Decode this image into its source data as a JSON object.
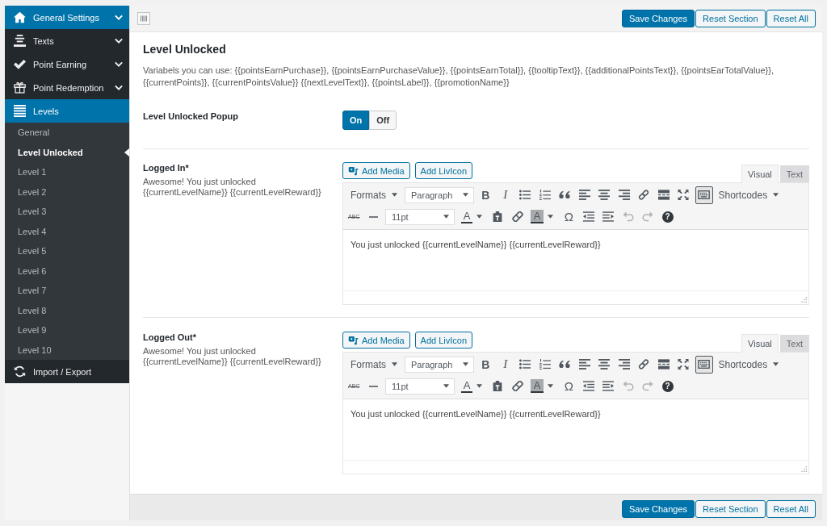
{
  "sidebar": {
    "items": [
      {
        "label": "General Settings",
        "selected": true,
        "expanded": false
      },
      {
        "label": "Texts",
        "selected": false,
        "expanded": false
      },
      {
        "label": "Point Earning",
        "selected": false,
        "expanded": false
      },
      {
        "label": "Point Redemption",
        "selected": false,
        "expanded": false
      },
      {
        "label": "Levels",
        "selected": true,
        "expanded": true,
        "children": [
          {
            "label": "General",
            "selected": false
          },
          {
            "label": "Level Unlocked",
            "selected": true
          },
          {
            "label": "Level 1",
            "selected": false
          },
          {
            "label": "Level 2",
            "selected": false
          },
          {
            "label": "Level 3",
            "selected": false
          },
          {
            "label": "Level 4",
            "selected": false
          },
          {
            "label": "Level 5",
            "selected": false
          },
          {
            "label": "Level 6",
            "selected": false
          },
          {
            "label": "Level 7",
            "selected": false
          },
          {
            "label": "Level 8",
            "selected": false
          },
          {
            "label": "Level 9",
            "selected": false
          },
          {
            "label": "Level 10",
            "selected": false
          }
        ]
      },
      {
        "label": "Import / Export",
        "selected": false
      }
    ]
  },
  "top_bar": {
    "buttons": [
      {
        "label": "Save Changes",
        "kind": "primary"
      },
      {
        "label": "Reset Section",
        "kind": "secondary"
      },
      {
        "label": "Reset All",
        "kind": "secondary"
      }
    ]
  },
  "section": {
    "title": "Level Unlocked",
    "description": "Variabels you can use: {{pointsEarnPurchase}}, {{pointsEarnPurchaseValue}}, {{pointsEarnTotal}}, {{tooltipText}}, {{additionalPointsText}}, {{pointsEarTotalValue}}, {{currentPoints}}, {{currentPointsValue}} {{nextLevelText}}, {{pointsLabel}}, {{promotionName}}"
  },
  "popup_setting": {
    "label": "Level Unlocked Popup",
    "options": [
      {
        "label": "On",
        "selected": true
      },
      {
        "label": "Off",
        "selected": false
      }
    ]
  },
  "editors": [
    {
      "label": "Logged In*",
      "description": "Awesome! You just unlocked {{currentLevelName}} {{currentLevelReward}}",
      "media_buttons": [
        "Add Media",
        "Add LivIcon"
      ],
      "tabs": [
        {
          "label": "Visual",
          "selected": true
        },
        {
          "label": "Text",
          "selected": false
        }
      ],
      "toolbar": {
        "formats_menu": "Formats",
        "block_format": "Paragraph",
        "bold": "B",
        "italic": "I",
        "shortcodes_menu": "Shortcodes",
        "strikethrough": "ABC",
        "font_size": "11pt",
        "text_color": "A",
        "background_color": "A",
        "special_character": "Ω",
        "help": "?",
        "toolbar_toggle_on": true,
        "undo_disabled": true,
        "redo_disabled": true
      },
      "content": "You just unlocked {{currentLevelName}} {{currentLevelReward}}"
    },
    {
      "label": "Logged Out*",
      "description": "Awesome! You just unlocked {{currentLevelName}} {{currentLevelReward}}",
      "media_buttons": [
        "Add Media",
        "Add LivIcon"
      ],
      "tabs": [
        {
          "label": "Visual",
          "selected": true
        },
        {
          "label": "Text",
          "selected": false
        }
      ],
      "toolbar": {
        "formats_menu": "Formats",
        "block_format": "Paragraph",
        "bold": "B",
        "italic": "I",
        "shortcodes_menu": "Shortcodes",
        "strikethrough": "ABC",
        "font_size": "11pt",
        "text_color": "A",
        "background_color": "A",
        "special_character": "Ω",
        "help": "?",
        "toolbar_toggle_on": true,
        "undo_disabled": true,
        "redo_disabled": true
      },
      "content": "You just unlocked {{currentLevelName}} {{currentLevelReward}}"
    }
  ],
  "bottom_bar": {
    "buttons": [
      {
        "label": "Save Changes",
        "kind": "primary"
      },
      {
        "label": "Reset Section",
        "kind": "secondary"
      },
      {
        "label": "Reset All",
        "kind": "secondary"
      }
    ]
  }
}
